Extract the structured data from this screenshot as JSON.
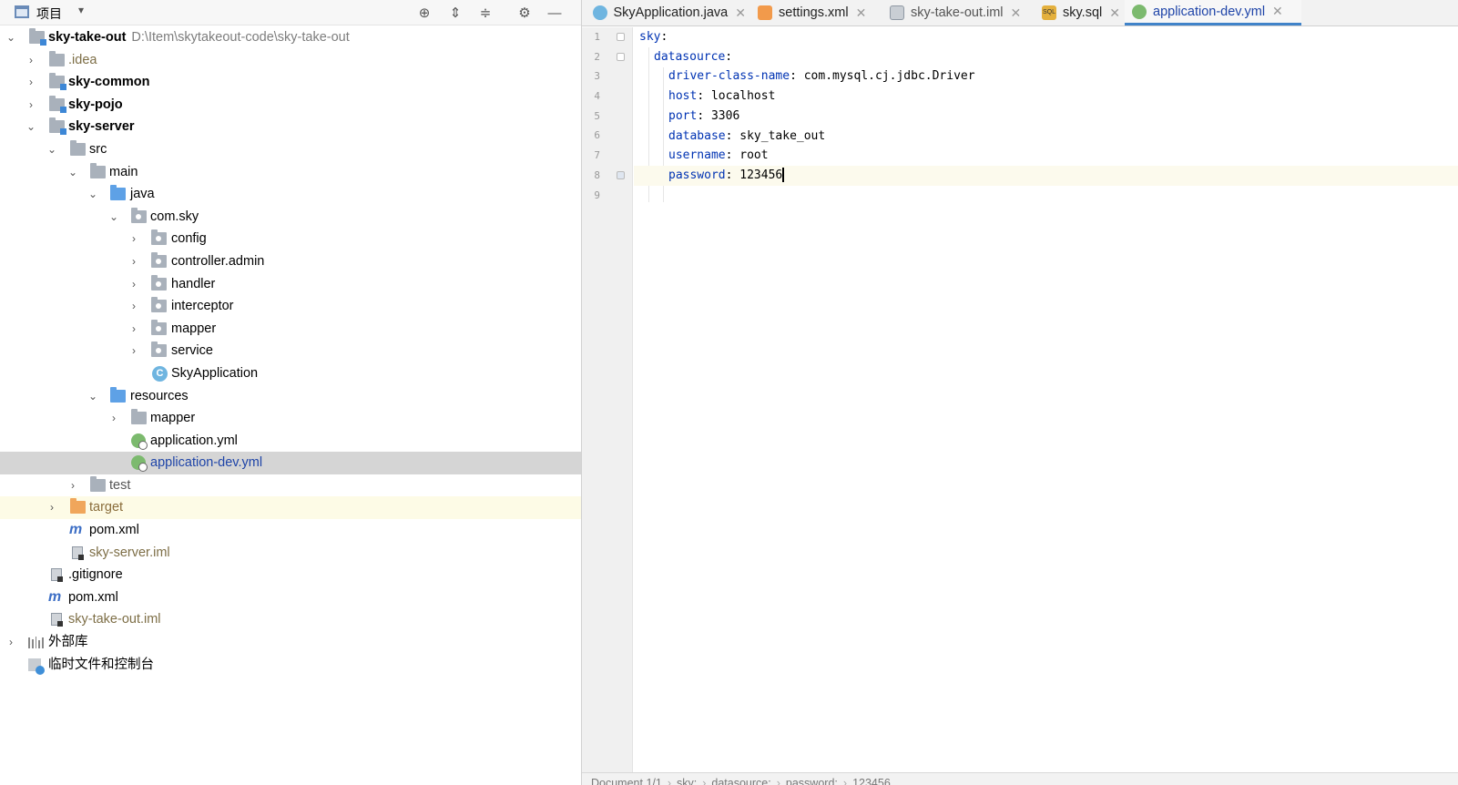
{
  "project_panel": {
    "title": "项目",
    "dropdown": "▾",
    "toolbar_icons": [
      "locate-icon",
      "expand-all-icon",
      "collapse-all-icon",
      "settings-icon",
      "minimize-icon"
    ]
  },
  "tree": {
    "root": {
      "name": "sky-take-out",
      "path": "D:\\Item\\skytakeout-code\\sky-take-out"
    },
    "idea": ".idea",
    "sky_common": "sky-common",
    "sky_pojo": "sky-pojo",
    "sky_server": "sky-server",
    "src": "src",
    "main": "main",
    "java": "java",
    "com_sky": "com.sky",
    "config": "config",
    "controller_admin": "controller.admin",
    "handler": "handler",
    "interceptor": "interceptor",
    "mapper": "mapper",
    "service": "service",
    "sky_application": "SkyApplication",
    "resources": "resources",
    "res_mapper": "mapper",
    "application_yml": "application.yml",
    "application_dev_yml": "application-dev.yml",
    "test": "test",
    "target": "target",
    "server_pom": "pom.xml",
    "server_iml": "sky-server.iml",
    "gitignore": ".gitignore",
    "root_pom": "pom.xml",
    "root_iml": "sky-take-out.iml",
    "external_libs": "外部库",
    "scratches": "临时文件和控制台"
  },
  "tabs": [
    {
      "label": "SkyApplication.java",
      "active": false
    },
    {
      "label": "settings.xml",
      "active": false
    },
    {
      "label": "sky-take-out.iml",
      "active": false
    },
    {
      "label": "sky.sql",
      "active": false
    },
    {
      "label": "application-dev.yml",
      "active": true
    }
  ],
  "editor": {
    "line_numbers": [
      "1",
      "2",
      "3",
      "4",
      "5",
      "6",
      "7",
      "8",
      "9"
    ],
    "lines": [
      {
        "key": "sky",
        "sep": ":",
        "value": ""
      },
      {
        "key": "datasource",
        "sep": ":",
        "value": ""
      },
      {
        "key": "driver-class-name",
        "sep": ": ",
        "value": "com.mysql.cj.jdbc.Driver"
      },
      {
        "key": "host",
        "sep": ": ",
        "value": "localhost"
      },
      {
        "key": "port",
        "sep": ": ",
        "value": "3306"
      },
      {
        "key": "database",
        "sep": ": ",
        "value": "sky_take_out"
      },
      {
        "key": "username",
        "sep": ": ",
        "value": "root"
      },
      {
        "key": "password",
        "sep": ": ",
        "value": "123456"
      }
    ],
    "current_line": 8
  },
  "breadcrumb": {
    "items": [
      "Document 1/1",
      "sky:",
      "datasource:",
      "password:",
      "123456"
    ]
  }
}
